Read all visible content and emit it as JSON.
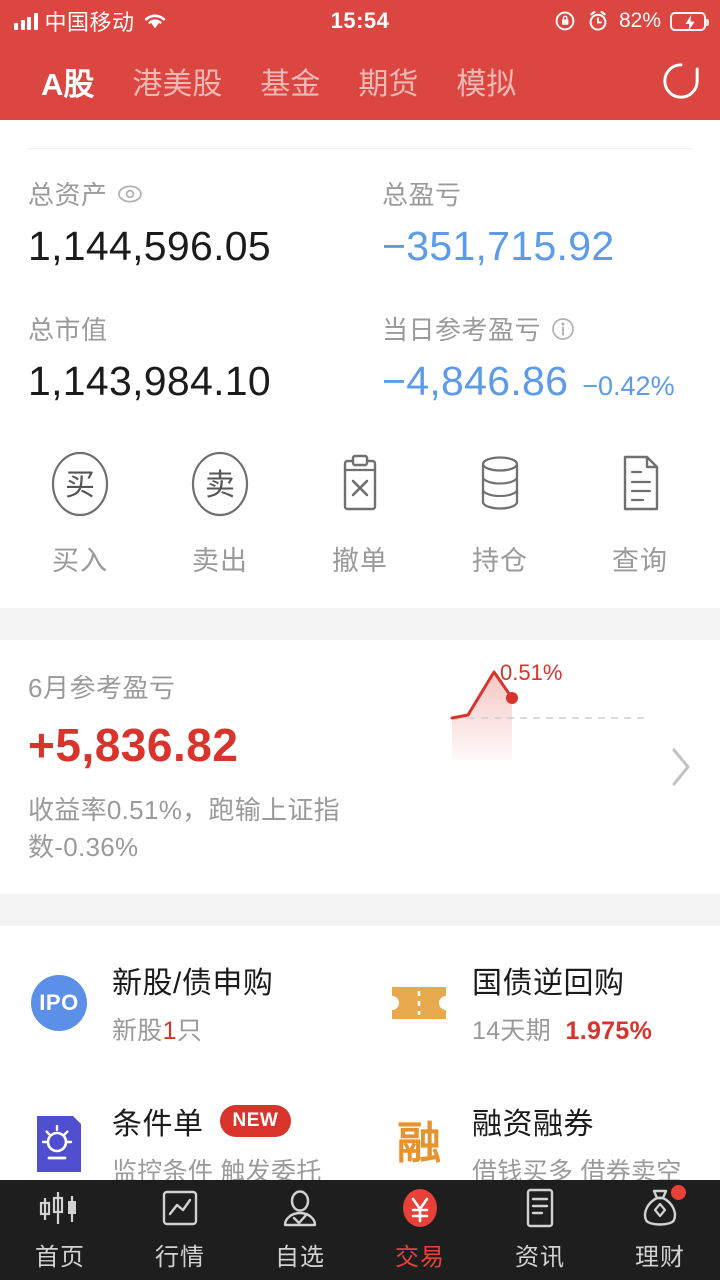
{
  "status_bar": {
    "carrier": "中国移动",
    "time": "15:54",
    "battery_percent": "82%",
    "icons": [
      "signal-icon",
      "wifi-icon",
      "rotation-lock-icon",
      "alarm-icon",
      "battery-charging-icon"
    ]
  },
  "top_nav": {
    "tabs": [
      {
        "label": "A股",
        "active": true
      },
      {
        "label": "港美股",
        "active": false
      },
      {
        "label": "基金",
        "active": false
      },
      {
        "label": "期货",
        "active": false
      },
      {
        "label": "模拟",
        "active": false
      }
    ],
    "refresh_icon": "refresh-icon",
    "background_color": "#DC4641"
  },
  "assets": {
    "total_assets_label": "总资产",
    "total_assets_value": "1,144,596.05",
    "total_pnl_label": "总盈亏",
    "total_pnl_value": "−351,715.92",
    "market_value_label": "总市值",
    "market_value_value": "1,143,984.10",
    "today_pnl_label": "当日参考盈亏",
    "today_pnl_value": "−4,846.86",
    "today_pnl_percent": "−0.42%",
    "loss_color": "#5B9BE8"
  },
  "actions": [
    {
      "label": "买入",
      "icon": "buy-circle-icon",
      "glyph": "买"
    },
    {
      "label": "卖出",
      "icon": "sell-circle-icon",
      "glyph": "卖"
    },
    {
      "label": "撤单",
      "icon": "cancel-order-clipboard-icon"
    },
    {
      "label": "持仓",
      "icon": "holdings-database-icon"
    },
    {
      "label": "查询",
      "icon": "query-document-icon"
    }
  ],
  "monthly_pnl": {
    "title": "6月参考盈亏",
    "amount": "+5,836.82",
    "subtitle": "收益率0.51%，跑输上证指数-0.36%",
    "spark_label": "0.51%",
    "profit_color": "#D9342B",
    "chevron_icon": "chevron-right-icon"
  },
  "chart_data": {
    "type": "line",
    "title": "6月参考盈亏",
    "series": [
      {
        "name": "收益率",
        "values": [
          0.02,
          0.05,
          0.72,
          0.51
        ]
      }
    ],
    "x": [
      0,
      1,
      2,
      3
    ],
    "annotations": [
      "0.51%"
    ],
    "ylabel": "",
    "xlabel": "",
    "grid": false,
    "baseline": 0,
    "line_color": "#D9342B",
    "fill": true,
    "marker_at": 3
  },
  "features": [
    {
      "title": "新股/债申购",
      "sub_prefix": "新股",
      "sub_highlight": "1",
      "sub_suffix": "只",
      "icon": "ipo-badge-icon",
      "icon_text": "IPO",
      "icon_color": "#5B8FE8"
    },
    {
      "title": "国债逆回购",
      "sub_prefix": "14天期",
      "rate": "1.975%",
      "icon": "bond-ticket-icon",
      "icon_color": "#E8A84E"
    },
    {
      "title": "条件单",
      "badge": "NEW",
      "sub": "监控条件 触发委托",
      "icon": "conditional-order-bulb-icon",
      "icon_color": "#4F4FD0"
    },
    {
      "title": "融资融券",
      "sub": "借钱买多 借券卖空",
      "icon": "margin-trading-icon",
      "icon_text": "融",
      "icon_color": "#E8922E"
    }
  ],
  "bottom_nav": [
    {
      "label": "首页",
      "icon": "candlestick-icon",
      "active": false,
      "badge": false
    },
    {
      "label": "行情",
      "icon": "market-chart-icon",
      "active": false,
      "badge": false
    },
    {
      "label": "自选",
      "icon": "watchlist-person-icon",
      "active": false,
      "badge": false
    },
    {
      "label": "交易",
      "icon": "trade-yuan-icon",
      "active": true,
      "badge": false
    },
    {
      "label": "资讯",
      "icon": "news-document-icon",
      "active": false,
      "badge": false
    },
    {
      "label": "理财",
      "icon": "wealth-moneybag-icon",
      "active": false,
      "badge": true
    }
  ]
}
